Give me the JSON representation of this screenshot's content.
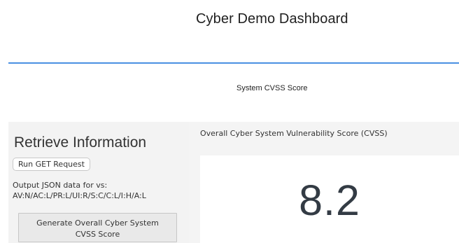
{
  "header": {
    "title": "Cyber Demo Dashboard",
    "accent_color": "#4a90e2"
  },
  "system_section": {
    "title": "System CVSS Score"
  },
  "sidebar": {
    "title": "Retrieve Information",
    "get_button_label": "Run GET Request",
    "output_label_line1": "Output JSON data for vs:",
    "output_label_line2": "AV:N/AC:L/PR:L/UI:R/S:C/C:L/I:H/A:L",
    "generate_button_line1": "Generate Overall Cyber System",
    "generate_button_line2": "CVSS Score"
  },
  "score": {
    "caption": "Overall Cyber System Vulnerability Score (CVSS)",
    "value": "8.2"
  }
}
